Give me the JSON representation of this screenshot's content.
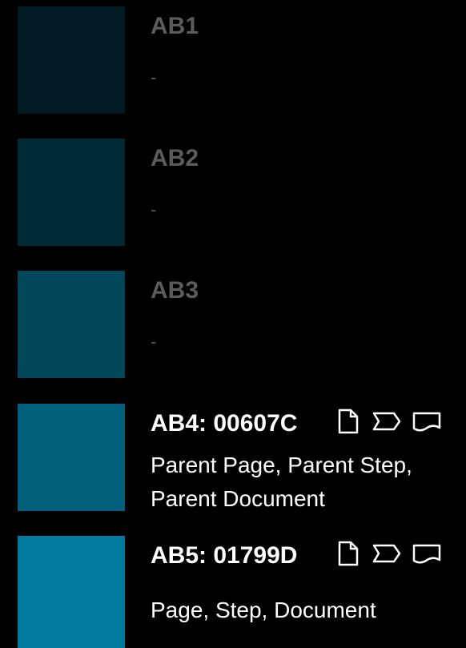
{
  "swatches": [
    {
      "name": "AB1",
      "title": "AB1",
      "hex": "#001a22",
      "description": "-"
    },
    {
      "name": "AB2",
      "title": "AB2",
      "hex": "#002a36",
      "description": "-"
    },
    {
      "name": "AB3",
      "title": "AB3",
      "hex": "#00475a",
      "description": "-"
    },
    {
      "name": "AB4",
      "title": "AB4: 00607C",
      "hex": "#00607c",
      "description": "Parent Page, Parent Step, Parent Document",
      "icons": [
        "page-icon",
        "step-icon",
        "document-icon"
      ]
    },
    {
      "name": "AB5",
      "title": "AB5: 01799D",
      "hex": "#01799d",
      "description": "Page, Step, Document",
      "icons": [
        "page-icon",
        "step-icon",
        "document-icon"
      ]
    }
  ],
  "colors": {
    "background": "#000000",
    "muted_text": "#5c5c5c",
    "bright_text": "#ffffff"
  }
}
